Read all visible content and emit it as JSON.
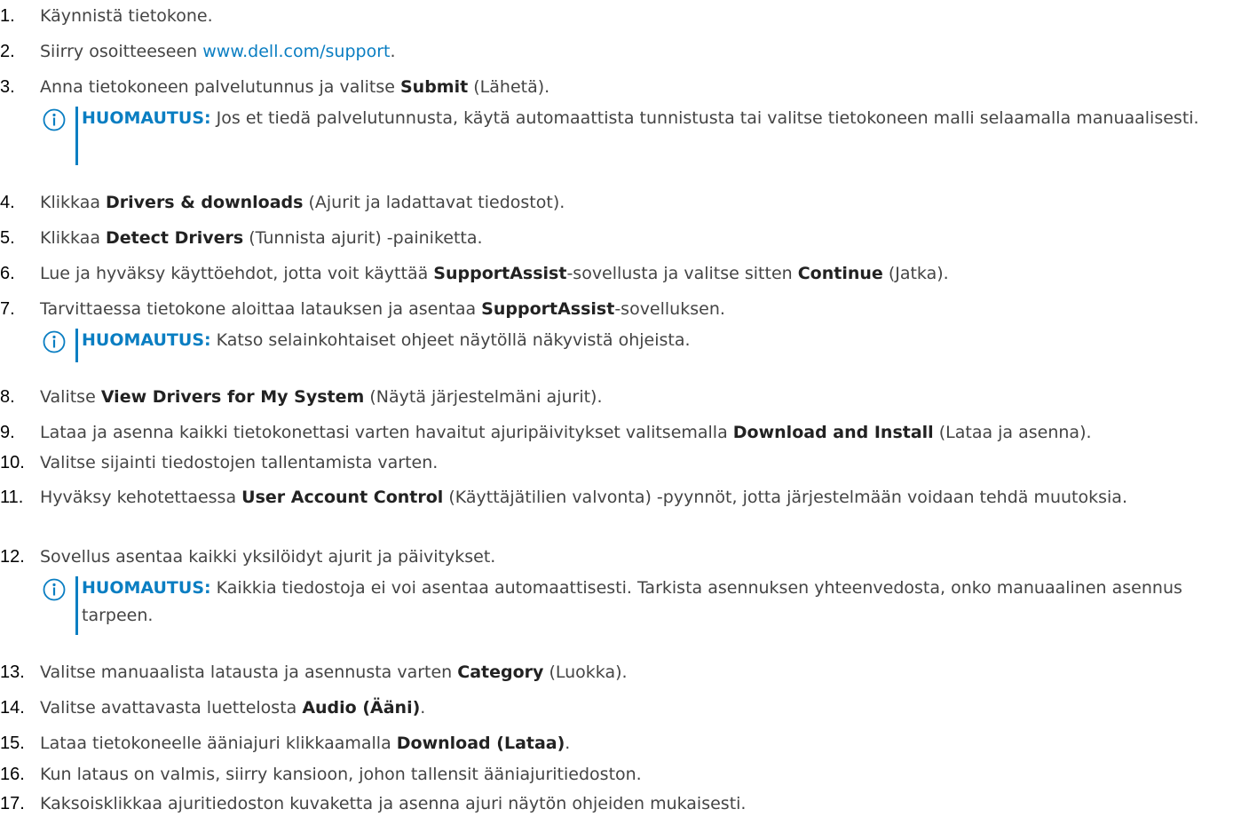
{
  "steps": [
    {
      "num": "1.",
      "text": "Käynnistä tietokone."
    },
    {
      "num": "2.",
      "before": "Siirry osoitteeseen ",
      "link": "www.dell.com/support",
      "after": "."
    },
    {
      "num": "3.",
      "before": "Anna tietokoneen palvelutunnus ja valitse ",
      "bold": "Submit",
      "after": " (Lähetä)."
    },
    {
      "num": "4.",
      "before": "Klikkaa ",
      "bold": "Drivers & downloads",
      "after": " (Ajurit ja ladattavat tiedostot)."
    },
    {
      "num": "5.",
      "before": "Klikkaa ",
      "bold": "Detect Drivers",
      "after": " (Tunnista ajurit) -painiketta."
    },
    {
      "num": "6.",
      "before": "Lue ja hyväksy käyttöehdot, jotta voit käyttää ",
      "bold": "SupportAssist",
      "middle": "-sovellusta ja valitse sitten ",
      "bold2": "Continue",
      "after": " (Jatka)."
    },
    {
      "num": "7.",
      "before": "Tarvittaessa tietokone aloittaa latauksen ja asentaa ",
      "bold": "SupportAssist",
      "after": "-sovelluksen."
    },
    {
      "num": "8.",
      "before": "Valitse ",
      "bold": "View Drivers for My System",
      "after": " (Näytä järjestelmäni ajurit)."
    },
    {
      "num": "9.",
      "before": "Lataa ja asenna kaikki tietokonettasi varten havaitut ajuripäivitykset valitsemalla ",
      "bold": "Download and Install",
      "after": " (Lataa ja asenna)."
    },
    {
      "num": "10.",
      "text": "Valitse sijainti tiedostojen tallentamista varten."
    },
    {
      "num": "11.",
      "before": "Hyväksy kehotettaessa ",
      "bold": "User Account Control",
      "after": " (Käyttäjätilien valvonta) -pyynnöt, jotta järjestelmään voidaan tehdä muutoksia."
    },
    {
      "num": "12.",
      "text": "Sovellus asentaa kaikki yksilöidyt ajurit ja päivitykset."
    },
    {
      "num": "13.",
      "before": "Valitse manuaalista latausta ja asennusta varten ",
      "bold": "Category",
      "after": " (Luokka)."
    },
    {
      "num": "14.",
      "before": "Valitse avattavasta luettelosta ",
      "bold": "Audio (Ääni)",
      "after": "."
    },
    {
      "num": "15.",
      "before": "Lataa tietokoneelle ääniajuri klikkaamalla ",
      "bold": "Download (Lataa)",
      "after": "."
    },
    {
      "num": "16.",
      "text": "Kun lataus on valmis, siirry kansioon, johon tallensit ääniajuritiedoston."
    },
    {
      "num": "17.",
      "text": "Kaksoisklikkaa ajuritiedoston kuvaketta ja asenna ajuri näytön ohjeiden mukaisesti."
    }
  ],
  "notes": [
    {
      "label": "HUOMAUTUS:",
      "text": " Jos et tiedä palvelutunnusta, käytä automaattista tunnistusta tai valitse tietokoneen malli selaamalla manuaalisesti."
    },
    {
      "label": "HUOMAUTUS:",
      "text": " Katso selainkohtaiset ohjeet näytöllä näkyvistä ohjeista."
    },
    {
      "label": "HUOMAUTUS:",
      "text": " Kaikkia tiedostoja ei voi asentaa automaattisesti. Tarkista asennuksen yhteenvedosta, onko manuaalinen asennus tarpeen."
    }
  ],
  "icons": {
    "note": "info-icon"
  },
  "colors": {
    "accent": "#0a7ec2",
    "text": "#444444",
    "number": "#000000"
  }
}
